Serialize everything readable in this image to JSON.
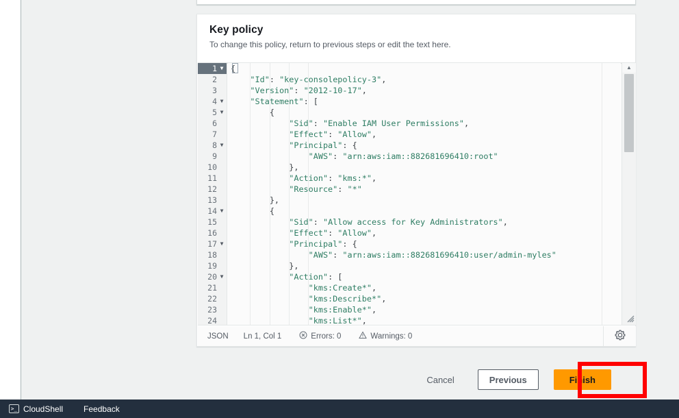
{
  "card": {
    "title": "Key policy",
    "subtitle": "To change this policy, return to previous steps or edit the text here."
  },
  "editor": {
    "lines": [
      {
        "num": "1",
        "fold": true,
        "active": true,
        "text": "{"
      },
      {
        "num": "2",
        "fold": false,
        "active": false,
        "text": "    \"Id\": \"key-consolepolicy-3\","
      },
      {
        "num": "3",
        "fold": false,
        "active": false,
        "text": "    \"Version\": \"2012-10-17\","
      },
      {
        "num": "4",
        "fold": true,
        "active": false,
        "text": "    \"Statement\": ["
      },
      {
        "num": "5",
        "fold": true,
        "active": false,
        "text": "        {"
      },
      {
        "num": "6",
        "fold": false,
        "active": false,
        "text": "            \"Sid\": \"Enable IAM User Permissions\","
      },
      {
        "num": "7",
        "fold": false,
        "active": false,
        "text": "            \"Effect\": \"Allow\","
      },
      {
        "num": "8",
        "fold": true,
        "active": false,
        "text": "            \"Principal\": {"
      },
      {
        "num": "9",
        "fold": false,
        "active": false,
        "text": "                \"AWS\": \"arn:aws:iam::882681696410:root\""
      },
      {
        "num": "10",
        "fold": false,
        "active": false,
        "text": "            },"
      },
      {
        "num": "11",
        "fold": false,
        "active": false,
        "text": "            \"Action\": \"kms:*\","
      },
      {
        "num": "12",
        "fold": false,
        "active": false,
        "text": "            \"Resource\": \"*\""
      },
      {
        "num": "13",
        "fold": false,
        "active": false,
        "text": "        },"
      },
      {
        "num": "14",
        "fold": true,
        "active": false,
        "text": "        {"
      },
      {
        "num": "15",
        "fold": false,
        "active": false,
        "text": "            \"Sid\": \"Allow access for Key Administrators\","
      },
      {
        "num": "16",
        "fold": false,
        "active": false,
        "text": "            \"Effect\": \"Allow\","
      },
      {
        "num": "17",
        "fold": true,
        "active": false,
        "text": "            \"Principal\": {"
      },
      {
        "num": "18",
        "fold": false,
        "active": false,
        "text": "                \"AWS\": \"arn:aws:iam::882681696410:user/admin-myles\""
      },
      {
        "num": "19",
        "fold": false,
        "active": false,
        "text": "            },"
      },
      {
        "num": "20",
        "fold": true,
        "active": false,
        "text": "            \"Action\": ["
      },
      {
        "num": "21",
        "fold": false,
        "active": false,
        "text": "                \"kms:Create*\","
      },
      {
        "num": "22",
        "fold": false,
        "active": false,
        "text": "                \"kms:Describe*\","
      },
      {
        "num": "23",
        "fold": false,
        "active": false,
        "text": "                \"kms:Enable*\","
      },
      {
        "num": "24",
        "fold": false,
        "active": false,
        "text": "                \"kms:List*\","
      }
    ]
  },
  "status": {
    "language": "JSON",
    "position": "Ln 1, Col 1",
    "errors": "Errors: 0",
    "warnings": "Warnings: 0",
    "gear_icon": "gear-icon"
  },
  "actions": {
    "cancel": "Cancel",
    "previous": "Previous",
    "finish": "Finish",
    "highlight_color": "#ff0000",
    "finish_color": "#ff9900"
  },
  "bottom_bar": {
    "cloudshell": "CloudShell",
    "cloudshell_icon": ">_",
    "feedback": "Feedback",
    "background": "#232f3e"
  }
}
